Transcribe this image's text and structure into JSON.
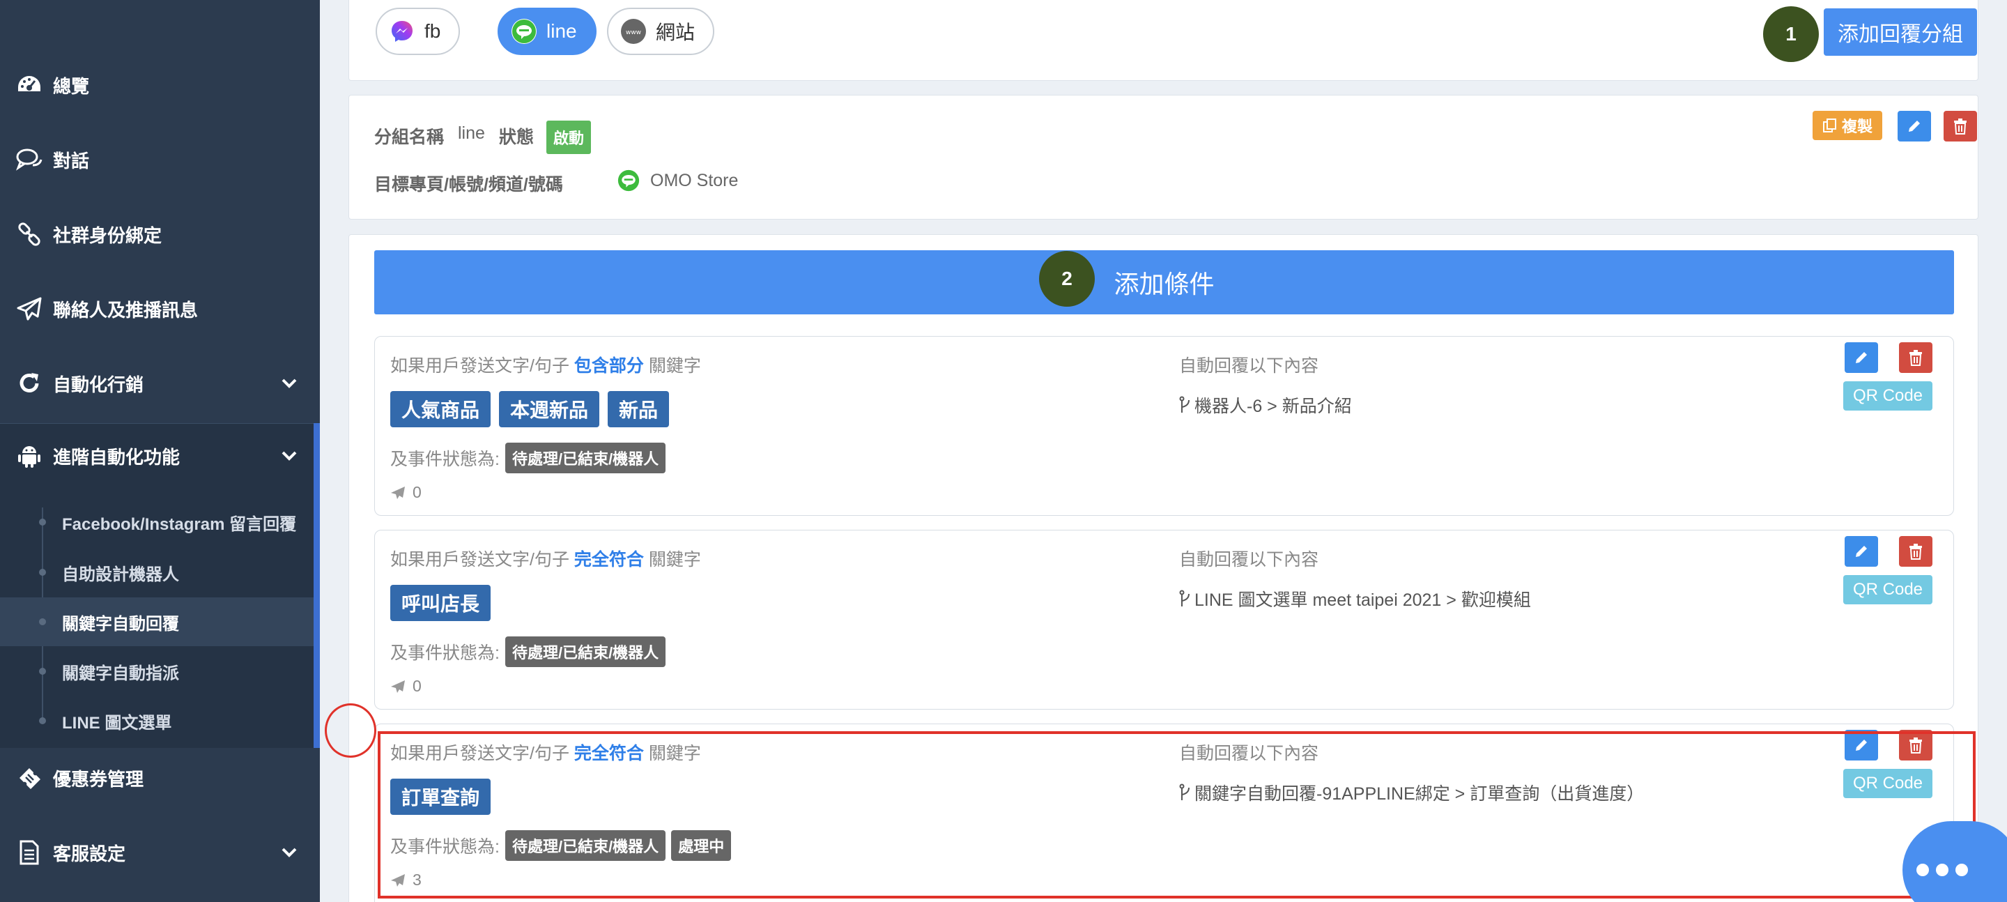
{
  "sidebar": {
    "items": [
      {
        "label": "總覽",
        "icon": "dashboard-icon"
      },
      {
        "label": "對話",
        "icon": "chat-icon"
      },
      {
        "label": "社群身份綁定",
        "icon": "link-icon"
      },
      {
        "label": "聯絡人及推播訊息",
        "icon": "paper-plane-icon"
      },
      {
        "label": "自動化行銷",
        "icon": "refresh-icon"
      },
      {
        "label": "進階自動化功能",
        "icon": "android-icon"
      },
      {
        "label": "優惠券管理",
        "icon": "ticket-icon"
      },
      {
        "label": "客服設定",
        "icon": "document-icon"
      }
    ],
    "subitems": [
      {
        "label": "Facebook/Instagram 留言回覆"
      },
      {
        "label": "自助設計機器人"
      },
      {
        "label": "關鍵字自動回覆",
        "active": true
      },
      {
        "label": "關鍵字自動指派"
      },
      {
        "label": "LINE 圖文選單"
      }
    ]
  },
  "channel_tabs": [
    {
      "label": "fb",
      "icon": "messenger-icon"
    },
    {
      "label": "line",
      "icon": "line-icon",
      "active": true
    },
    {
      "label": "網站",
      "icon": "www-icon"
    }
  ],
  "add_group_button": "添加回覆分組",
  "step_markers": [
    "1",
    "2"
  ],
  "group": {
    "name_label": "分組名稱",
    "name_value": "line",
    "status_label": "狀態",
    "status_value": "啟動",
    "target_label": "目標專頁/帳號/頻道/號碼",
    "target_value": "OMO Store",
    "copy_label": "複製"
  },
  "add_condition_button": "添加條件",
  "rules": [
    {
      "prefix": "如果用戶發送文字/句子",
      "match_type": "包含部分",
      "suffix": "關鍵字",
      "keywords": [
        "人氣商品",
        "本週新品",
        "新品"
      ],
      "reply_label": "自動回覆以下內容",
      "reply_content": "機器人-6 > 新品介紹",
      "status_label": "及事件狀態為:",
      "status_tags": [
        "待處理/已結束/機器人"
      ],
      "sent_count": "0",
      "qr_label": "QR Code"
    },
    {
      "prefix": "如果用戶發送文字/句子",
      "match_type": "完全符合",
      "suffix": "關鍵字",
      "keywords": [
        "呼叫店長"
      ],
      "reply_label": "自動回覆以下內容",
      "reply_content": "LINE 圖文選單 meet taipei 2021 > 歡迎模組",
      "status_label": "及事件狀態為:",
      "status_tags": [
        "待處理/已結束/機器人"
      ],
      "sent_count": "0",
      "qr_label": "QR Code"
    },
    {
      "prefix": "如果用戶發送文字/句子",
      "match_type": "完全符合",
      "suffix": "關鍵字",
      "keywords": [
        "訂單查詢"
      ],
      "reply_label": "自動回覆以下內容",
      "reply_content": "關鍵字自動回覆-91APPLINE綁定 > 訂單查詢（出貨進度）",
      "status_label": "及事件狀態為:",
      "status_tags": [
        "待處理/已結束/機器人",
        "處理中"
      ],
      "sent_count": "3",
      "qr_label": "QR Code"
    }
  ],
  "colors": {
    "sidebar_bg": "#2c3b4f",
    "primary": "#4a8ff0",
    "keyword_tag": "#336aac",
    "danger": "#d24c40",
    "highlight": "#e0322a",
    "step_marker": "#3c5220"
  }
}
